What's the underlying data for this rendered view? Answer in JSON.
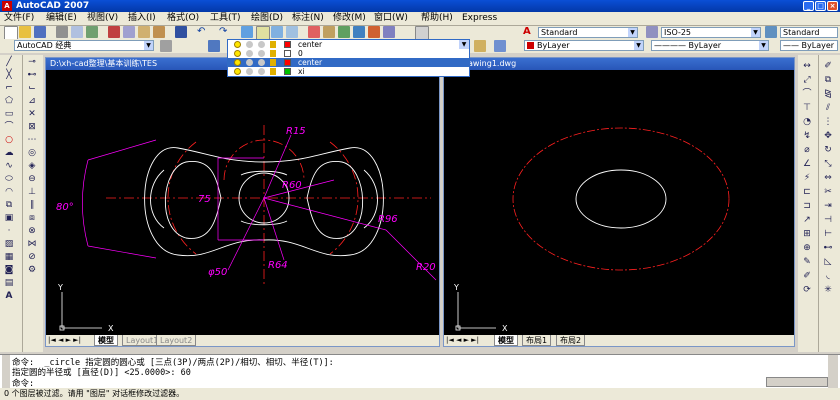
{
  "app": {
    "title": "AutoCAD 2007",
    "window_buttons": [
      "_",
      "□",
      "×"
    ]
  },
  "menu": [
    "文件(F)",
    "编辑(E)",
    "视图(V)",
    "插入(I)",
    "格式(O)",
    "工具(T)",
    "绘图(D)",
    "标注(N)",
    "修改(M)",
    "窗口(W)",
    "帮助(H)",
    "Express"
  ],
  "toolbar": {
    "text_style": "Standard",
    "dim_style": "ISO-25",
    "table_style": "Standard",
    "workspace": "AutoCAD 经典",
    "current_layer": "center",
    "color": "ByLayer",
    "linetype": "ByLayer",
    "lineweight": "ByLayer"
  },
  "layers": [
    {
      "name": "center",
      "color": "#ff0000",
      "selected": false
    },
    {
      "name": "0",
      "color": "#ffffff",
      "selected": false
    },
    {
      "name": "center",
      "color": "#ff0000",
      "selected": true
    },
    {
      "name": "xi",
      "color": "#00c000",
      "selected": false
    }
  ],
  "viewport_left": {
    "title": "D:\\xh-cad整理\\基本训练\\TES",
    "tabs": [
      "模型",
      "Layout1",
      "Layout2"
    ],
    "ucs": {
      "x": "X",
      "y": "Y"
    },
    "dimensions": {
      "r15": "R15",
      "r60": "R60",
      "r96": "R96",
      "r20": "R20",
      "r64": "R64",
      "d50": "φ50",
      "d75": "75",
      "a80": "80°"
    }
  },
  "viewport_right": {
    "title": "awing1.dwg",
    "tabs": [
      "模型",
      "布局1",
      "布局2"
    ],
    "ucs": {
      "x": "X",
      "y": "Y"
    }
  },
  "command": {
    "line1": "命令:  _circle 指定圆的圆心或 [三点(3P)/两点(2P)/相切、相切、半径(T)]:",
    "line2": "指定圆的半径或 [直径(D)] <25.0000>: 60",
    "line3": "命令:"
  },
  "status": "0 个图层被过滤。请用 \"图层\" 对话框修改过滤器。",
  "colors": {
    "drawing_white": "#ffffff",
    "center_red": "#ff2020",
    "dimension_magenta": "#ff00ff",
    "title_blue": "#0338a8"
  }
}
